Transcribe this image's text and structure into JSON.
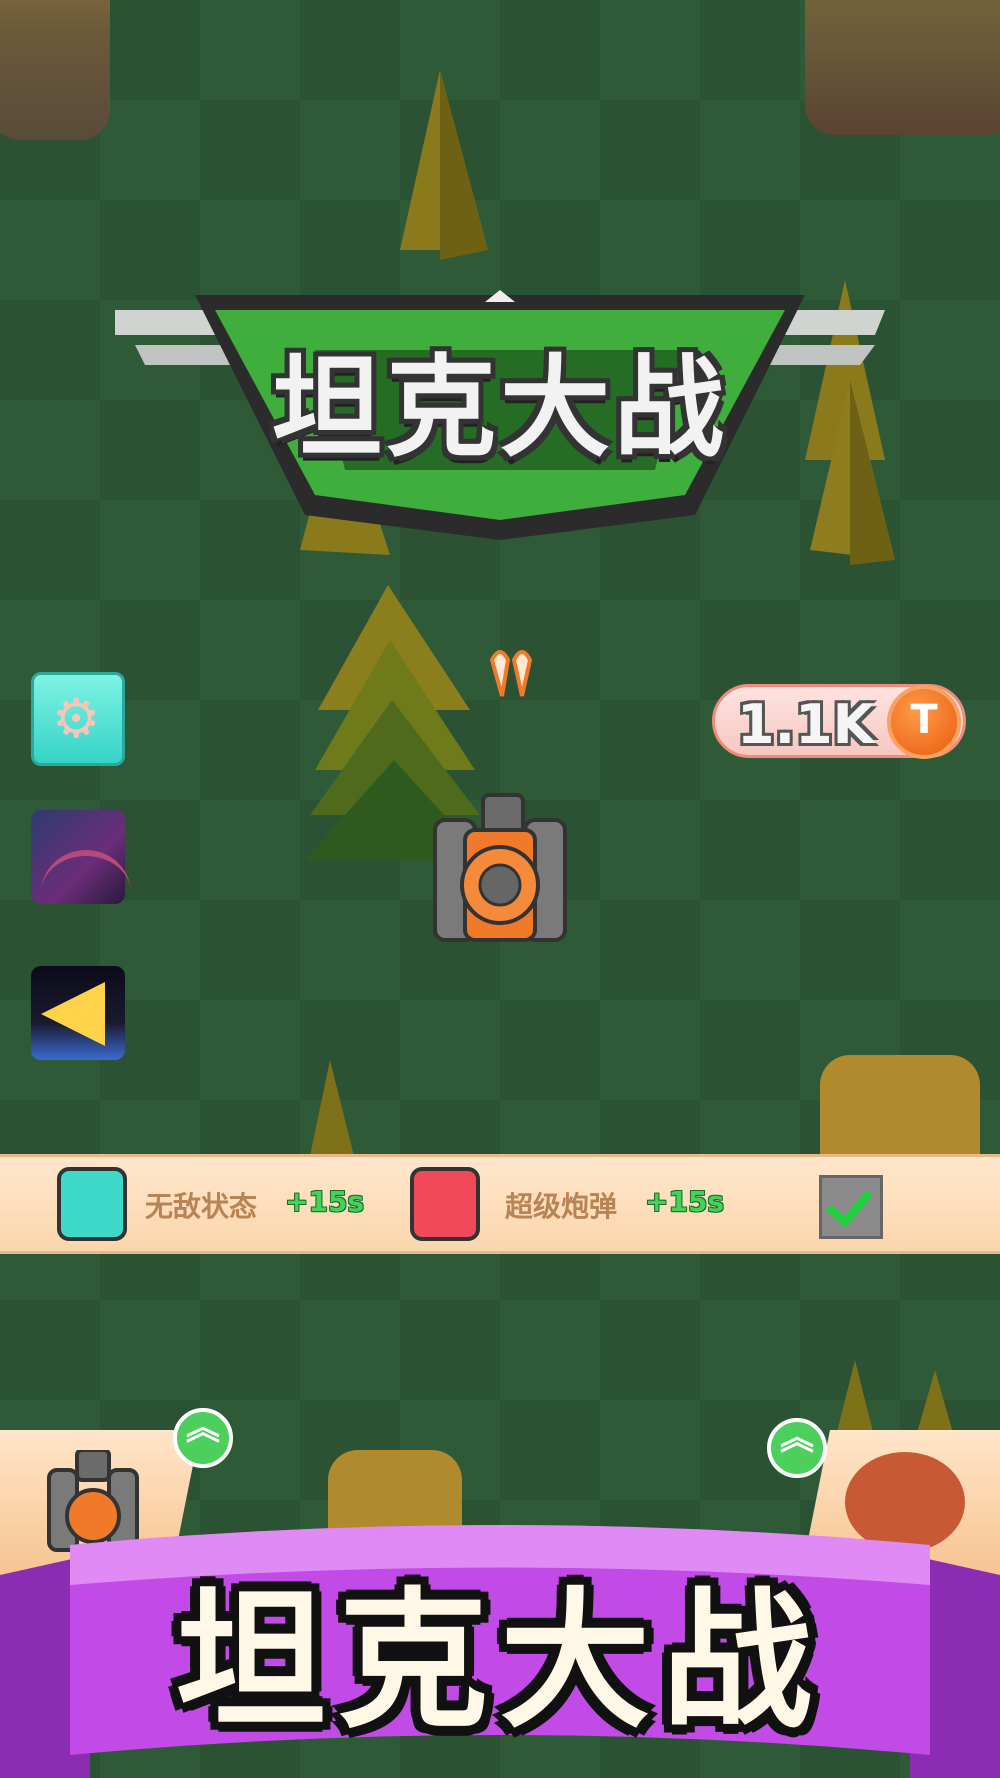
{
  "game": {
    "logo_title": "坦克大战",
    "banner_title": "坦克大战"
  },
  "hud": {
    "coins": "1.1K",
    "coin_symbol": "T"
  },
  "buffs": [
    {
      "label": "无敌状态",
      "bonus": "+15s",
      "icon": "shield-buff-icon",
      "color": "#3fd9c9"
    },
    {
      "label": "超级炮弹",
      "bonus": "+15s",
      "icon": "ammo-buff-icon",
      "color": "#f04a5a"
    }
  ],
  "side_buttons": [
    {
      "name": "settings-button",
      "icon": "gear-icon"
    },
    {
      "name": "promo-game-1",
      "icon": "space-game-icon"
    },
    {
      "name": "promo-game-2",
      "icon": "triangle-game-icon"
    }
  ],
  "colors": {
    "board_dark": "#2a5233",
    "board_light": "#2e5a37",
    "banner_purple": "#b03ed8",
    "accent_orange": "#f07a2a",
    "bonus_green": "#44d35a"
  }
}
